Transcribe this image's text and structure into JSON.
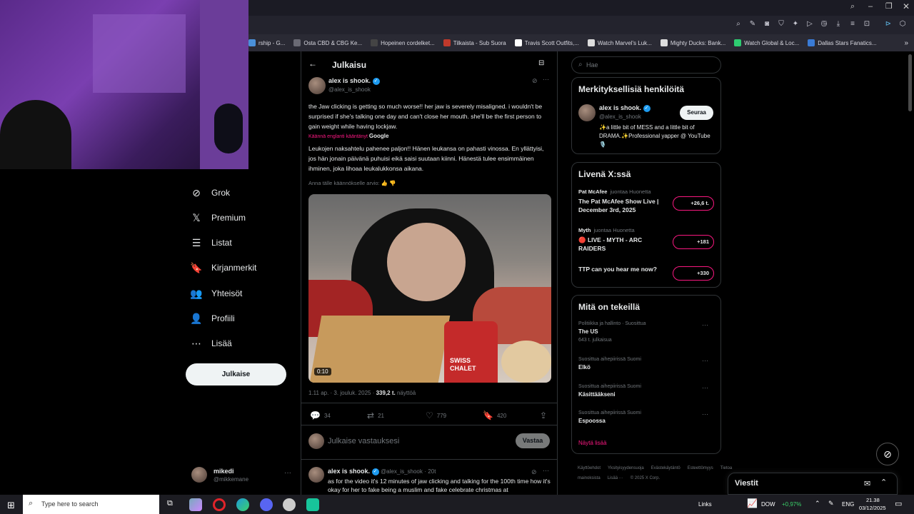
{
  "browser": {
    "bookmarks": [
      {
        "label": "rship - G...",
        "color": "#4a90d9"
      },
      {
        "label": "Osta CBD & CBG Ke...",
        "color": "#6a6a74"
      },
      {
        "label": "Hopeinen cordelket...",
        "color": "#444"
      },
      {
        "label": "Tilkaista - Sub Suora",
        "color": "#c0392b"
      },
      {
        "label": "Travis Scott Outfits,...",
        "color": "#fff"
      },
      {
        "label": "Watch Marvel's Luk...",
        "color": "#ddd"
      },
      {
        "label": "Mighty Ducks: Bank...",
        "color": "#ddd"
      },
      {
        "label": "Watch Global & Loc...",
        "color": "#2ecc71"
      },
      {
        "label": "Dallas Stars Fanatics...",
        "color": "#3a7bd5"
      }
    ]
  },
  "nav": {
    "items": [
      {
        "label": "Grok",
        "icon": "grok-icon",
        "glyph": "⊘"
      },
      {
        "label": "Premium",
        "icon": "x-logo-icon",
        "glyph": "𝕏"
      },
      {
        "label": "Listat",
        "icon": "list-icon",
        "glyph": "☰"
      },
      {
        "label": "Kirjanmerkit",
        "icon": "bookmark-icon",
        "glyph": "🔖"
      },
      {
        "label": "Yhteisöt",
        "icon": "communities-icon",
        "glyph": "👥"
      },
      {
        "label": "Profiili",
        "icon": "profile-icon",
        "glyph": "👤"
      },
      {
        "label": "Lisää",
        "icon": "more-icon",
        "glyph": "⋯"
      }
    ],
    "post_button": "Julkaise",
    "account": {
      "name": "mikedi",
      "handle": "@mikkemane"
    }
  },
  "post": {
    "header_title": "Julkaisu",
    "author_name": "alex is shook.",
    "author_handle": "@alex_is_shook",
    "text": "the Jaw clicking is getting so much worse!! her jaw is severely misaligned. i wouldn't be surprised if she's talking one day and can't close her mouth. she'll be the first person to gain weight while having lockjaw.",
    "translation_label": "Käännä englanti kääntänyt",
    "translation_provider": "Google",
    "translated_text": "Leukojen naksahtelu pahenee paljon!! Hänen leukansa on pahasti vinossa. En yllättyisi, jos hän jonain päivänä puhuisi eikä saisi suutaan kiinni. Hänestä tulee ensimmäinen ihminen, joka lihoaa leukalukkonsa aikana.",
    "rate_translation": "Anna tälle käännökselle arvio:",
    "video_duration": "0:10",
    "video_text": "SWISS CHALET",
    "timestamp": "1.11 ap. · 3. jouluk. 2025 ·",
    "views_count": "339,2 t.",
    "views_label": "näyttöä",
    "replies": "34",
    "reposts": "21",
    "likes": "779",
    "bookmarks": "420",
    "reply_placeholder": "Julkaise vastauksesi",
    "reply_button": "Vastaa"
  },
  "reply": {
    "author_name": "alex is shook.",
    "author_handle": "@alex_is_shook",
    "time": "· 20t",
    "text": "as for the video it's 12 minutes of jaw clicking and talking for the 100th time how it's okay for her to fake being a muslim and fake celebrate christmas at"
  },
  "sidebar": {
    "search_placeholder": "Hae",
    "relevant": {
      "title": "Merkityksellisiä henkilöitä",
      "name": "alex is shook.",
      "handle": "@alex_is_shook",
      "follow_label": "Seuraa",
      "bio": "✨a little bit of MESS and a little bit of DRAMA.✨Professional yapper @ YouTube 🎙️"
    },
    "live": {
      "title": "Livenä X:ssä",
      "items": [
        {
          "host": "Pat McAfee",
          "status": "juontaa Huonetta",
          "title": "The Pat McAfee Show Live | December 3rd, 2025",
          "count": "+26,6 t."
        },
        {
          "host": "Myth",
          "status": "juontaa Huonetta",
          "title": "🔴 LIVE - MYTH - ARC RAIDERS",
          "count": "+181"
        },
        {
          "host": "",
          "status": "",
          "title": "TTP can you hear me now?",
          "count": "+330"
        }
      ]
    },
    "happening": {
      "title": "Mitä on tekeillä",
      "items": [
        {
          "meta": "Politiikka ja hallinto · Suosittua",
          "name": "The US",
          "posts": "643 t. julkaisua"
        },
        {
          "meta": "Suosittua aihepiirissä Suomi",
          "name": "Elkö",
          "posts": ""
        },
        {
          "meta": "Suosittua aihepiirissä Suomi",
          "name": "Käsittääkseni",
          "posts": ""
        },
        {
          "meta": "Suosittua aihepiirissä Suomi",
          "name": "Espoossa",
          "posts": ""
        }
      ],
      "show_more": "Näytä lisää"
    },
    "footer": [
      "Käyttöehdot",
      "Yksityisyydensuoja",
      "Evästekäytäntö",
      "Esteettömyys",
      "Tietoa mainoksista",
      "Lisää ···",
      "© 2025 X Corp."
    ],
    "messages_label": "Viestit"
  },
  "taskbar": {
    "search_placeholder": "Type here to search",
    "links_label": "Links",
    "stock": "DOW",
    "stock_change": "+0,97%",
    "lang": "ENG",
    "time": "21.38",
    "date": "03/12/2025"
  }
}
